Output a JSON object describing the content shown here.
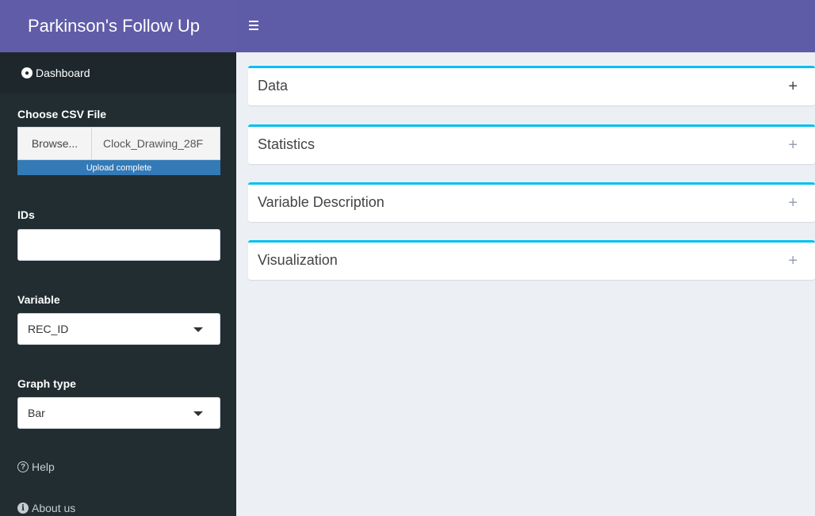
{
  "header": {
    "title": "Parkinson's Follow Up"
  },
  "sidebar": {
    "dashboard_label": "Dashboard",
    "file_label": "Choose CSV File",
    "browse_label": "Browse...",
    "file_name": "Clock_Drawing_28F",
    "upload_status": "Upload complete",
    "upload_progress": 1.0,
    "ids_label": "IDs",
    "ids_value": "",
    "variable_label": "Variable",
    "variable_value": "REC_ID",
    "graph_label": "Graph type",
    "graph_value": "Bar",
    "help_label": "Help",
    "about_label": "About us"
  },
  "main": {
    "boxes": [
      {
        "title": "Data"
      },
      {
        "title": "Statistics"
      },
      {
        "title": "Variable Description"
      },
      {
        "title": "Visualization"
      }
    ],
    "expand_symbol": "+"
  },
  "colors": {
    "header": "#605ca8",
    "sidebar": "#222d32",
    "box_accent": "#00c0ef",
    "progress": "#337ab7",
    "content_bg": "#ecf0f5"
  },
  "icons": {
    "dashboard": "dashboard-icon",
    "help": "question-circle-icon",
    "about": "info-circle-icon",
    "menu": "hamburger-icon",
    "select_caret": "caret-down-icon"
  }
}
